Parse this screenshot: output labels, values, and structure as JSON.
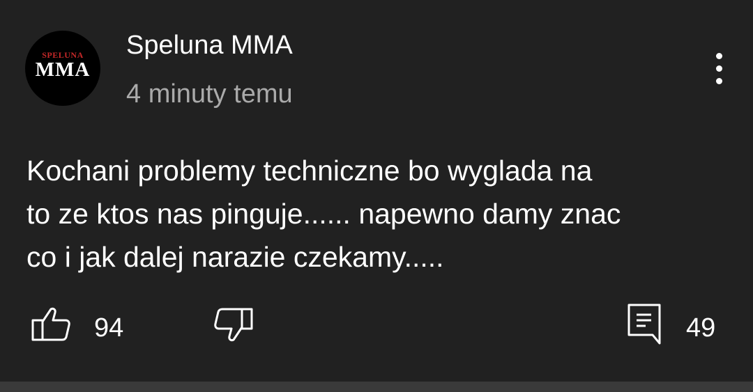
{
  "post": {
    "author": "Speluna MMA",
    "avatar_text_top": "SPELUNA",
    "avatar_text_main": "MMA",
    "time": "4 minuty temu",
    "text": "Kochani problemy techniczne bo wyglada na\nto ze ktos nas pinguje...... napewno damy znac\nco i jak dalej narazie czekamy....."
  },
  "actions": {
    "like_count": "94",
    "comment_count": "49"
  },
  "icons": {
    "like": "thumbs-up-icon",
    "dislike": "thumbs-down-icon",
    "comment": "comment-icon",
    "menu": "more-vertical-icon"
  },
  "colors": {
    "background": "#212121",
    "text": "#ffffff",
    "muted": "#aaaaaa",
    "logo_accent": "#c62828"
  }
}
